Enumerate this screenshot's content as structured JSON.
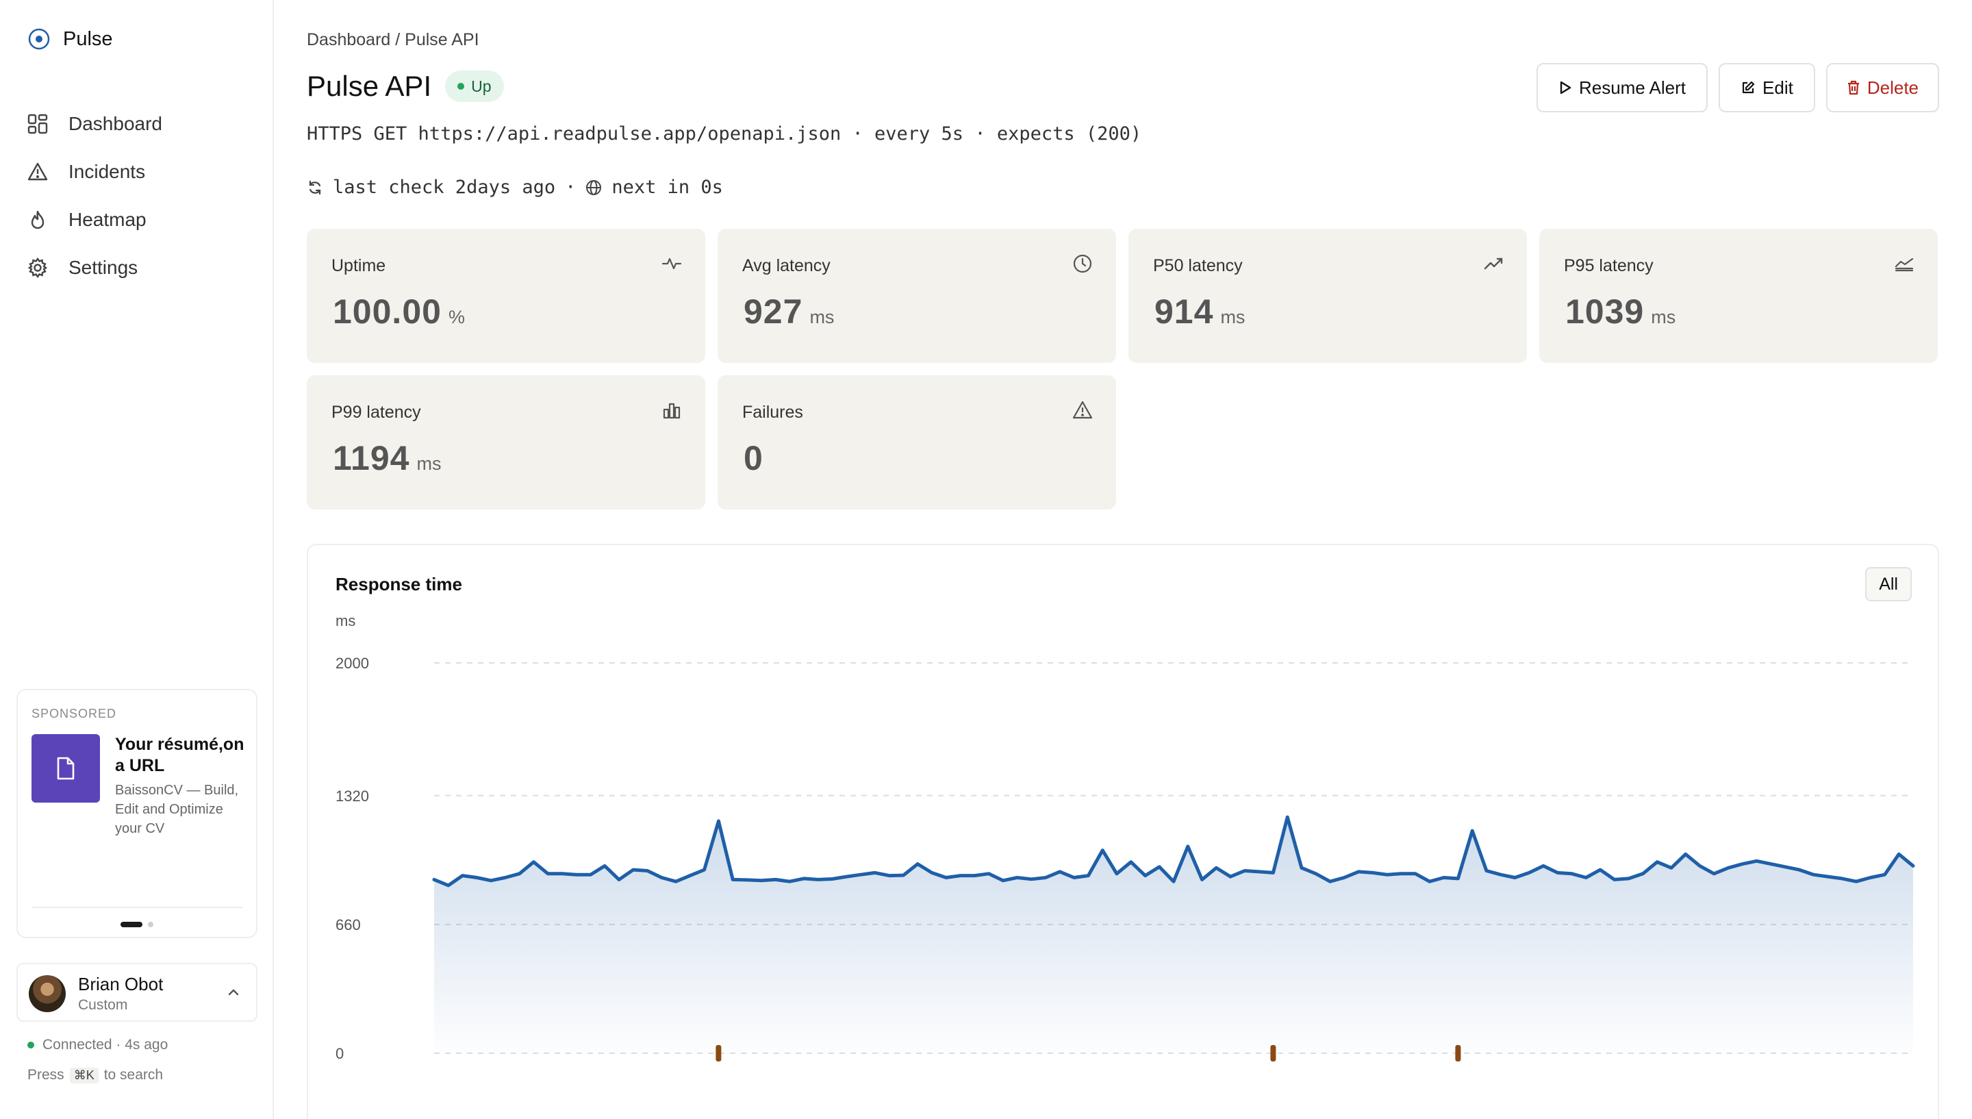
{
  "brand": {
    "name": "Pulse"
  },
  "nav": {
    "items": [
      {
        "label": "Dashboard",
        "icon": "grid-icon"
      },
      {
        "label": "Incidents",
        "icon": "warning-icon"
      },
      {
        "label": "Heatmap",
        "icon": "flame-icon"
      },
      {
        "label": "Settings",
        "icon": "gear-icon"
      }
    ]
  },
  "sponsor": {
    "tag": "SPONSORED",
    "title": "Your résumé,on a URL",
    "description": "BaissonCV — Build, Edit and Optimize your CV"
  },
  "user": {
    "name": "Brian Obot",
    "plan": "Custom"
  },
  "footer": {
    "status": "Connected · 4s ago",
    "press": "Press",
    "shortcut": "⌘K",
    "search_hint": "to search"
  },
  "header": {
    "breadcrumb": "Dashboard / Pulse API",
    "title": "Pulse API",
    "status": "Up",
    "description": "HTTPS GET https://api.readpulse.app/openapi.json · every 5s · expects (200)",
    "last_check": "last check 2days ago",
    "separator": "·",
    "next_check": "next in 0s"
  },
  "actions": {
    "resume": "Resume Alert",
    "edit": "Edit",
    "delete": "Delete"
  },
  "stats": [
    {
      "label": "Uptime",
      "value": "100.00",
      "unit": "%",
      "icon": "pulse-icon"
    },
    {
      "label": "Avg latency",
      "value": "927",
      "unit": "ms",
      "icon": "clock-icon"
    },
    {
      "label": "P50 latency",
      "value": "914",
      "unit": "ms",
      "icon": "trend-icon"
    },
    {
      "label": "P95 latency",
      "value": "1039",
      "unit": "ms",
      "icon": "area-chart-icon"
    },
    {
      "label": "P99 latency",
      "value": "1194",
      "unit": "ms",
      "icon": "bar-chart-icon"
    },
    {
      "label": "Failures",
      "value": "0",
      "unit": "",
      "icon": "warning-icon"
    }
  ],
  "chart": {
    "title": "Response time",
    "range": "All"
  },
  "colors": {
    "accent": "#1f5fa8",
    "status_up": "#22a35b",
    "delete": "#b3261e",
    "incident_marker": "#8a4a12"
  },
  "chart_data": {
    "type": "area",
    "ylabel": "ms",
    "ylim": [
      0,
      2000
    ],
    "yticks": [
      0,
      660,
      1320,
      2000
    ],
    "grid": true,
    "series": [
      {
        "values": [
          890,
          860,
          910,
          900,
          885,
          900,
          920,
          980,
          920,
          920,
          915,
          915,
          960,
          890,
          940,
          935,
          900,
          880,
          910,
          940,
          1190,
          890,
          888,
          885,
          890,
          880,
          895,
          890,
          893,
          905,
          915,
          925,
          910,
          912,
          970,
          925,
          900,
          910,
          910,
          920,
          885,
          900,
          892,
          900,
          930,
          900,
          910,
          1040,
          920,
          980,
          910,
          955,
          880,
          1060,
          890,
          950,
          905,
          935,
          930,
          925,
          1210,
          950,
          920,
          880,
          900,
          930,
          925,
          915,
          920,
          920,
          880,
          900,
          895,
          1140,
          935,
          915,
          900,
          925,
          960,
          925,
          920,
          900,
          940,
          890,
          895,
          920,
          980,
          950,
          1020,
          960,
          920,
          950,
          970,
          985,
          970,
          955,
          940,
          915,
          905,
          895,
          880,
          900,
          915,
          1020,
          960
        ]
      }
    ],
    "incident_markers": [
      20,
      59,
      72
    ]
  }
}
